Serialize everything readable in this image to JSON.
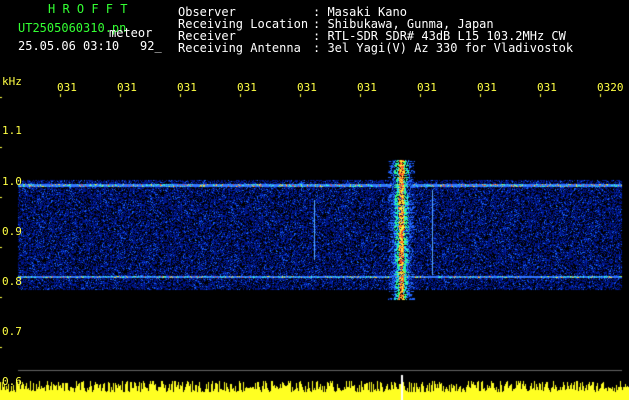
{
  "header": {
    "app_name": "H R O F F T",
    "filename": "UT2505060310.pn",
    "event_type": "meteor",
    "datetime": "25.05.06 03:10",
    "count": "92_",
    "labels": [
      "Observer",
      "Receiving Location",
      "Receiver",
      "Receiving Antenna"
    ],
    "values": [
      ": Masaki Kano",
      ": Shibukawa, Gunma, Japan",
      ": RTL-SDR SDR# 43dB L15 103.2MHz CW",
      ": 3el Yagi(V) Az 330 for Vladivostok"
    ]
  },
  "axis": {
    "y_unit": "kHz",
    "y_ticks": [
      "1.1",
      "1.0",
      "0.9",
      "0.8",
      "0.7",
      "0.6"
    ],
    "x_ticks": [
      "031",
      "031",
      "031",
      "031",
      "031",
      "031",
      "031",
      "031",
      "031",
      "0320"
    ]
  },
  "colors": {
    "title_green": "#33ff33",
    "tick_yellow": "#ffff44",
    "text_white": "#ffffff",
    "background": "#000000",
    "bands": "#2244ff"
  }
}
